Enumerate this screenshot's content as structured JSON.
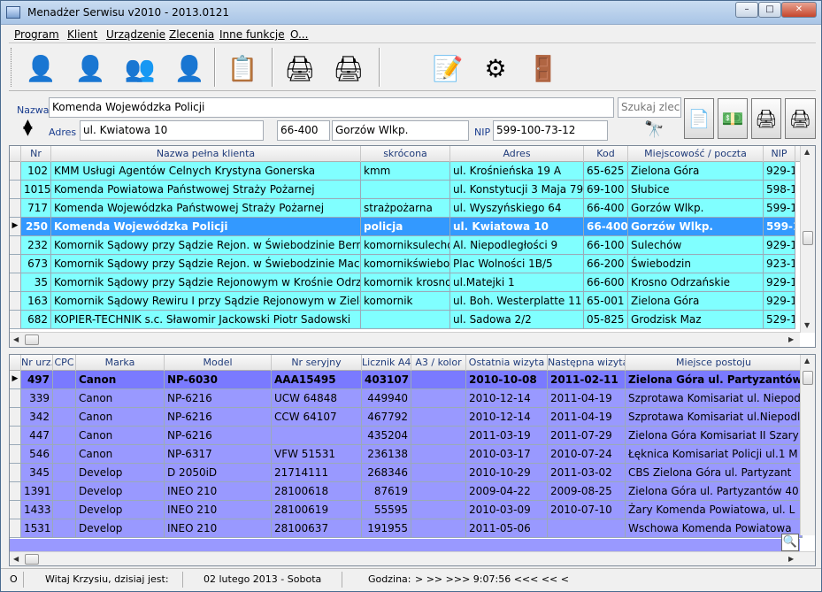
{
  "window": {
    "title": "Menadżer Serwisu v2010 - 2013.0121"
  },
  "menu": [
    "Program",
    "Klient",
    "Urządzenie",
    "Zlecenia",
    "Inne funkcje",
    "O..."
  ],
  "toolbar_icons": [
    "add-client-icon",
    "edit-client-icon",
    "search-client-icon",
    "delete-client-icon",
    "add-document-icon",
    "add-device-icon",
    "edit-device-icon",
    "calendar-note-icon",
    "settings-gears-icon",
    "exit-icon"
  ],
  "client_panel": {
    "name_label": "Nazwa",
    "name_value": "Komenda Wojewódzka Policji",
    "search_placeholder": "Szukaj zlece",
    "address_label": "Adres",
    "address_value": "ul. Kwiatowa 10",
    "postcode_value": "66-400",
    "city_value": "Gorzów Wlkp.",
    "nip_label": "NIP",
    "nip_value": "599-100-73-12"
  },
  "clients_table": {
    "columns": [
      "Nr",
      "Nazwa pełna klienta",
      "skrócona",
      "Adres",
      "Kod",
      "Miejscowość / poczta",
      "NIP"
    ],
    "rows": [
      [
        "102",
        "KMM Usługi Agentów Celnych    Krystyna Gonerska",
        "kmm",
        "ul. Krośnieńska 19 A",
        "65-625",
        "Zielona Góra",
        "929-1"
      ],
      [
        "1015",
        "Komenda Powiatowa Państwowej Straży Pożarnej",
        "",
        "ul. Konstytucji 3 Maja 79",
        "69-100",
        "Słubice",
        "598-1"
      ],
      [
        "717",
        "Komenda Wojewódzka Państwowej Straży Pożarnej",
        "strażpożarna",
        "ul. Wyszyńskiego 64",
        "66-400",
        "Gorzów Wlkp.",
        "599-1"
      ],
      [
        "250",
        "Komenda Wojewódzka Policji",
        "policja",
        "ul. Kwiatowa 10",
        "66-400",
        "Gorzów Wlkp.",
        "599-1"
      ],
      [
        "232",
        "Komornik Sądowy przy Sądzie Rejon. w Świebodzinie Bernar",
        "komorniksulechów",
        "Al. Niepodległości 9",
        "66-100",
        "Sulechów",
        "929-1"
      ],
      [
        "673",
        "Komornik Sądowy przy Sądzie Rejon. w Świebodzinie Maciej",
        "komornikświebod",
        "Plac Wolności 1B/5",
        "66-200",
        "Świebodzin",
        "923-1"
      ],
      [
        "35",
        "Komornik Sądowy przy Sądzie Rejonowym w Krośnie Odrzań",
        "komornik krosno",
        "ul.Matejki 1",
        "66-600",
        "Krosno Odrzańskie",
        "929-1"
      ],
      [
        "163",
        "Komornik Sądowy Rewiru I przy Sądzie Rejonowym w Zielon",
        "komornik",
        "ul. Boh. Westerplatte 11",
        "65-001",
        "Zielona Góra",
        "929-1"
      ],
      [
        "682",
        "KOPIER-TECHNIK s.c. Sławomir Jackowski  Piotr Sadowski",
        "",
        "ul. Sadowa 2/2",
        "05-825",
        "Grodzisk Maz",
        "529-1"
      ]
    ],
    "selected_index": 3
  },
  "devices_table": {
    "columns": [
      "Nr urz.",
      "CPC",
      "Marka",
      "Model",
      "Nr seryjny",
      "Licznik A4",
      "A3 / kolor",
      "Ostatnia wizyta",
      "Następna wizyta",
      "Miejsce postoju"
    ],
    "rows": [
      [
        "497",
        "",
        "Canon",
        "NP-6030",
        "AAA15495",
        "403107",
        "",
        "2010-10-08",
        "2011-02-11",
        "Zielona Góra ul. Partyzantów"
      ],
      [
        "339",
        "",
        "Canon",
        "NP-6216",
        "UCW 64848",
        "449940",
        "",
        "2010-12-14",
        "2011-04-19",
        "Szprotawa Komisariat ul. Niepod"
      ],
      [
        "342",
        "",
        "Canon",
        "NP-6216",
        "CCW 64107",
        "467792",
        "",
        "2010-12-14",
        "2011-04-19",
        "Szprotawa Komisariat ul.Niepodl"
      ],
      [
        "447",
        "",
        "Canon",
        "NP-6216",
        "",
        "435204",
        "",
        "2011-03-19",
        "2011-07-29",
        "Zielona Góra Komisariat II  Szary"
      ],
      [
        "546",
        "",
        "Canon",
        "NP-6317",
        "VFW 51531",
        "236138",
        "",
        "2010-03-17",
        "2010-07-24",
        "Łęknica Komisariat Policji  ul.1 M"
      ],
      [
        "345",
        "",
        "Develop",
        "D 2050iD",
        "21714111",
        "268346",
        "",
        "2010-10-29",
        "2011-03-02",
        "CBS  Zielona Góra  ul. Partyzant"
      ],
      [
        "1391",
        "",
        "Develop",
        "INEO 210",
        "28100618",
        "87619",
        "",
        "2009-04-22",
        "2009-08-25",
        "Zielona Góra ul. Partyzantów 40"
      ],
      [
        "1433",
        "",
        "Develop",
        "INEO 210",
        "28100619",
        "55595",
        "",
        "2010-03-09",
        "2010-07-10",
        "Żary  Komenda Powiatowa,  ul. L"
      ],
      [
        "1531",
        "",
        "Develop",
        "INEO 210",
        "28100637",
        "191955",
        "",
        "2011-05-06",
        "",
        "Wschowa Komenda Powiatowa"
      ]
    ],
    "selected_index": 0
  },
  "status": {
    "left": "O",
    "greeting": "Witaj Krzysiu, dzisiaj jest:",
    "date": "02 lutego 2013  -  Sobota",
    "time_label": "Godzina:",
    "time": "> >> >>>  9:07:56  <<< << <"
  },
  "colors": {
    "client_row": "#80ffff",
    "client_selected": "#3399ff",
    "device_row": "#9999ff",
    "device_selected": "#7a7aff"
  }
}
